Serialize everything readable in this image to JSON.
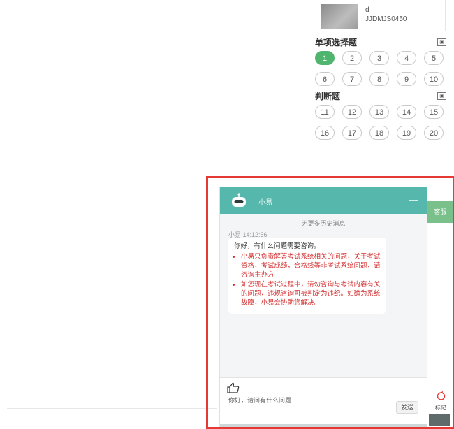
{
  "student": {
    "line1": "d",
    "line2": "JJDMJS0450"
  },
  "sections": [
    {
      "title": "单项选择题",
      "questions": [
        "1",
        "2",
        "3",
        "4",
        "5",
        "6",
        "7",
        "8",
        "9",
        "10"
      ],
      "active": "1"
    },
    {
      "title": "判断题",
      "questions": [
        "11",
        "12",
        "13",
        "14",
        "15",
        "16",
        "17",
        "18",
        "19",
        "20"
      ]
    }
  ],
  "chat": {
    "title": "小易",
    "minimize": "—",
    "no_more_history": "无更多历史消息",
    "sender_time": "小易  14:12:56",
    "greeting": "你好，有什么问题需要咨询。",
    "bullets": [
      "小易只负责解答考试系统相关的问题，关于考试资格，考试成绩，合格线等非考试系统问题，请咨询主办方",
      "如您现在考试过程中，请勿咨询与考试内容有关的问题，违规咨询可被判定为违纪。如确为系统故障，小易会协助您解决。"
    ],
    "input_placeholder": "你好，请问有什么问题",
    "send_label": "发送"
  },
  "side": {
    "service_label": "客服",
    "mark_label": "标记"
  },
  "colors": {
    "active_green": "#4fb46e",
    "chat_header": "#56b7ad",
    "highlight_red": "#e53935",
    "warning_text": "#d32f2f"
  }
}
